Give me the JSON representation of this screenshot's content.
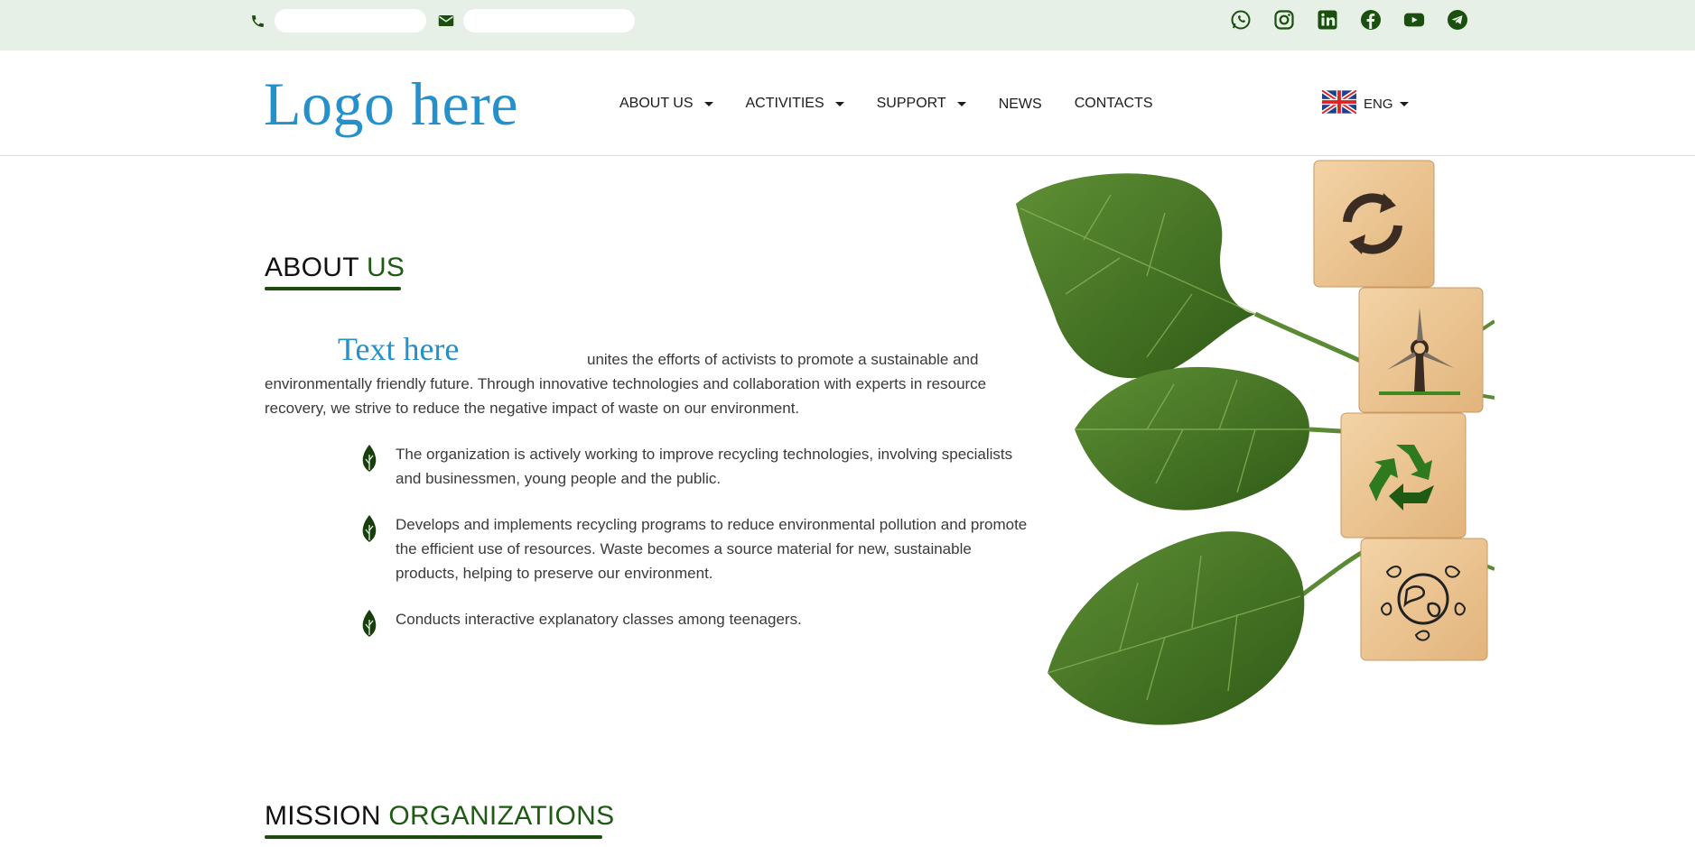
{
  "contacts": {
    "phone_icon": "phone-icon",
    "mail_icon": "mail-icon"
  },
  "socials": [
    {
      "name": "whatsapp-icon"
    },
    {
      "name": "instagram-icon"
    },
    {
      "name": "linkedin-icon"
    },
    {
      "name": "facebook-icon"
    },
    {
      "name": "youtube-icon"
    },
    {
      "name": "telegram-icon"
    }
  ],
  "header": {
    "logo": "Logo here",
    "nav": [
      {
        "label": "ABOUT US",
        "dropdown": true
      },
      {
        "label": "ACTIVITIES",
        "dropdown": true
      },
      {
        "label": "SUPPORT",
        "dropdown": true
      },
      {
        "label": "NEWS",
        "dropdown": false
      },
      {
        "label": "CONTACTS",
        "dropdown": false
      }
    ],
    "language": "ENG"
  },
  "about": {
    "title_main": "ABOUT ",
    "title_accent": "US",
    "brand": "Text here",
    "intro": "unites the efforts of activists to promote a sustainable and environmentally friendly future. Through innovative technologies and collaboration with experts in resource recovery, we strive to reduce the negative impact of waste on our environment.",
    "bullets": [
      "The organization is actively working to improve recycling technologies, involving specialists and businessmen, young people and the public.",
      "Develops and implements recycling programs to reduce environmental pollution and promote the efficient use of resources. Waste becomes a source material for new, sustainable products, helping to preserve our environment.",
      "Conducts interactive explanatory classes among teenagers."
    ]
  },
  "mission": {
    "title_main": "MISSION ",
    "title_accent": "ORGANIZATIONS"
  },
  "colors": {
    "topbar_bg": "#e7f0e6",
    "accent_green": "#1f5a14",
    "logo_blue": "#2590c9"
  }
}
